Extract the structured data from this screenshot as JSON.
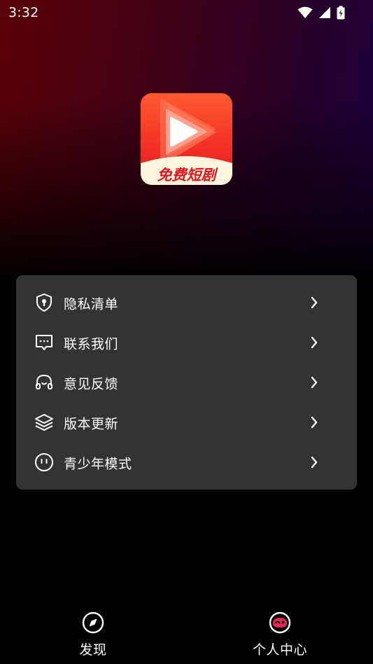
{
  "status_bar": {
    "time": "3:32",
    "icons": [
      "wifi-icon",
      "cellular-signal-icon",
      "battery-charging-icon"
    ]
  },
  "app": {
    "logo_text": "免费短剧",
    "logo_colors": {
      "top": "#ff5a30",
      "bottom": "#e8131e",
      "label_bg": "#fff6df",
      "label_text": "#e0141e"
    }
  },
  "menu": {
    "items": [
      {
        "label": "隐私清单",
        "icon": "shield-lock-icon"
      },
      {
        "label": "联系我们",
        "icon": "chat-bubble-icon"
      },
      {
        "label": "意见反馈",
        "icon": "headset-icon"
      },
      {
        "label": "版本更新",
        "icon": "layers-icon"
      },
      {
        "label": "青少年模式",
        "icon": "teen-mode-face-icon"
      }
    ]
  },
  "bottom_nav": {
    "items": [
      {
        "label": "发现",
        "icon": "compass-icon",
        "active": false
      },
      {
        "label": "个人中心",
        "icon": "profile-face-icon",
        "active": true
      }
    ]
  },
  "colors": {
    "background": "#000000",
    "card": "#333333",
    "accent": "#e8275a",
    "text": "#ffffff"
  }
}
